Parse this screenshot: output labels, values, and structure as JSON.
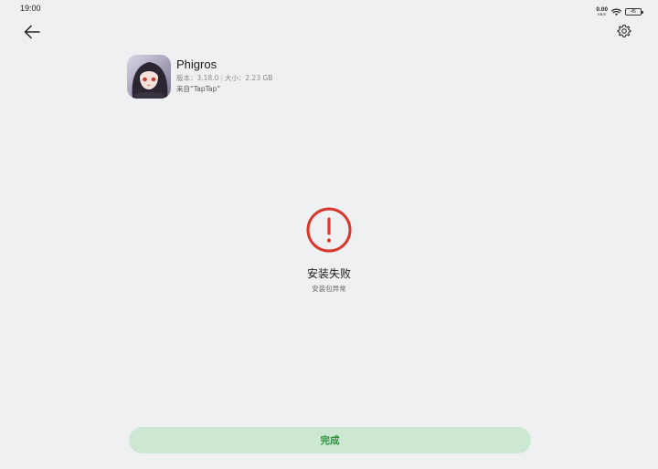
{
  "status_bar": {
    "time": "19:00",
    "net_speed_value": "0.00",
    "net_speed_unit": "KB/S",
    "battery": "45"
  },
  "header": {
    "back_icon": "arrow-left-icon",
    "settings_icon": "gear-icon"
  },
  "app": {
    "name": "Phigros",
    "version": "版本：3.18.0",
    "separator": "|",
    "size": "大小：2.23 GB",
    "source": "来自“TapTap”",
    "icon": "app-character-icon"
  },
  "result": {
    "icon": "exclamation-circle-icon",
    "title": "安装失败",
    "subtitle": "安装包异常",
    "accent_color": "#d9372c"
  },
  "footer": {
    "done_label": "完成",
    "button_bg": "#cce8d2",
    "button_text_color": "#2f8f3f"
  }
}
